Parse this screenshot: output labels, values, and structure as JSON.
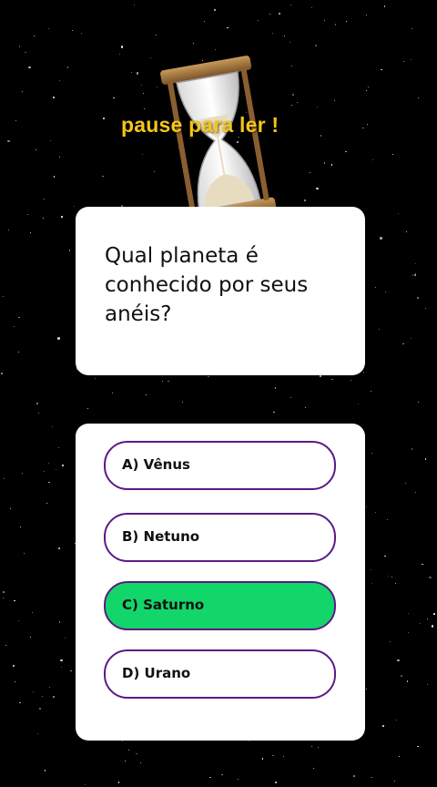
{
  "banner": {
    "text": "pause para ler !"
  },
  "question": {
    "text": "Qual planeta é conhecido por seus anéis?"
  },
  "options": [
    {
      "label": "A) Vênus",
      "correct": false
    },
    {
      "label": "B) Netuno",
      "correct": false
    },
    {
      "label": "C) Saturno",
      "correct": true
    },
    {
      "label": "D) Urano",
      "correct": false
    }
  ],
  "colors": {
    "background": "#000000",
    "card": "#ffffff",
    "option_border": "#5b1a86",
    "correct_fill": "#12d66a",
    "banner_text": "#f5c518"
  },
  "icons": {
    "timer": "hourglass-icon"
  }
}
